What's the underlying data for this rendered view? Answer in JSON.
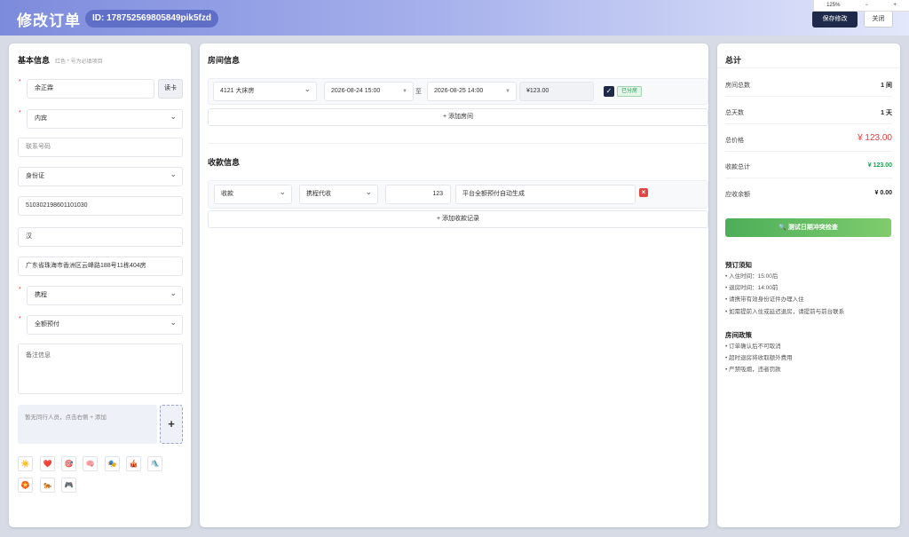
{
  "zoom": {
    "minus": "−",
    "level": "125%",
    "plus": "+"
  },
  "header": {
    "title": "修改订单",
    "order_id": "ID: 178752569805849pik5fzd",
    "save_label": "保存修改",
    "close_label": "关闭"
  },
  "basic": {
    "title": "基本信息",
    "hint": "红色 * 号为必填项目",
    "name": "余正霖",
    "read_card": "读卡",
    "gender": "内宾",
    "phone_placeholder": "联系号码",
    "id_type": "身份证",
    "id_number": "510302198601101030",
    "ethnicity": "汉",
    "address": "广东省珠海市香洲区云峰路188号11栋404房",
    "source": "携程",
    "payment": "全额预付",
    "remarks_placeholder": "备注信息",
    "companions_empty": "暂无同行人员，点击右侧 + 添加",
    "add_companion": "+",
    "emojis": [
      "☀️",
      "❤️",
      "🎯",
      "🧠",
      "🎭",
      "🎪",
      "🛝",
      "🏵️",
      "🐅",
      "🎮"
    ]
  },
  "rooms": {
    "title": "房间信息",
    "row": {
      "room": "4121 大床房",
      "checkin": "2026-08-24 15:00",
      "to": "至",
      "checkout": "2026-08-25 14:00",
      "price": "¥123.00",
      "status": "已分房"
    },
    "add_label": "+ 添加房间"
  },
  "payments": {
    "title": "收款信息",
    "row": {
      "type": "收款",
      "method": "携程代收",
      "amount": "123",
      "note": "平台全额预付自动生成"
    },
    "add_label": "+ 添加收款记录"
  },
  "summary": {
    "title": "总计",
    "lines": [
      {
        "label": "房间总数",
        "value": "1 间"
      },
      {
        "label": "总天数",
        "value": "1 天"
      },
      {
        "label": "总价格",
        "value": "¥ 123.00"
      },
      {
        "label": "收款总计",
        "value": "¥ 123.00"
      },
      {
        "label": "应收余额",
        "value": "¥ 0.00"
      }
    ],
    "check_button": "测试日期冲突检查",
    "booking_notice_title": "预订须知",
    "booking_notice": [
      "• 入住时间：15:00后",
      "• 退房时间：14:00前",
      "• 请携带有效身份证件办理入住",
      "• 如需提前入住或延迟退房，请提前与前台联系"
    ],
    "policy_title": "房间政策",
    "policy": [
      "• 订单确认后不可取消",
      "• 超时退房将收取额外费用",
      "• 严禁吸烟，违者罚款"
    ]
  },
  "colors": {
    "accent": "#1f2a4a",
    "price_red": "#e03c3c",
    "paid_green": "#1f9c4f",
    "button_green": "#57bb5f"
  }
}
